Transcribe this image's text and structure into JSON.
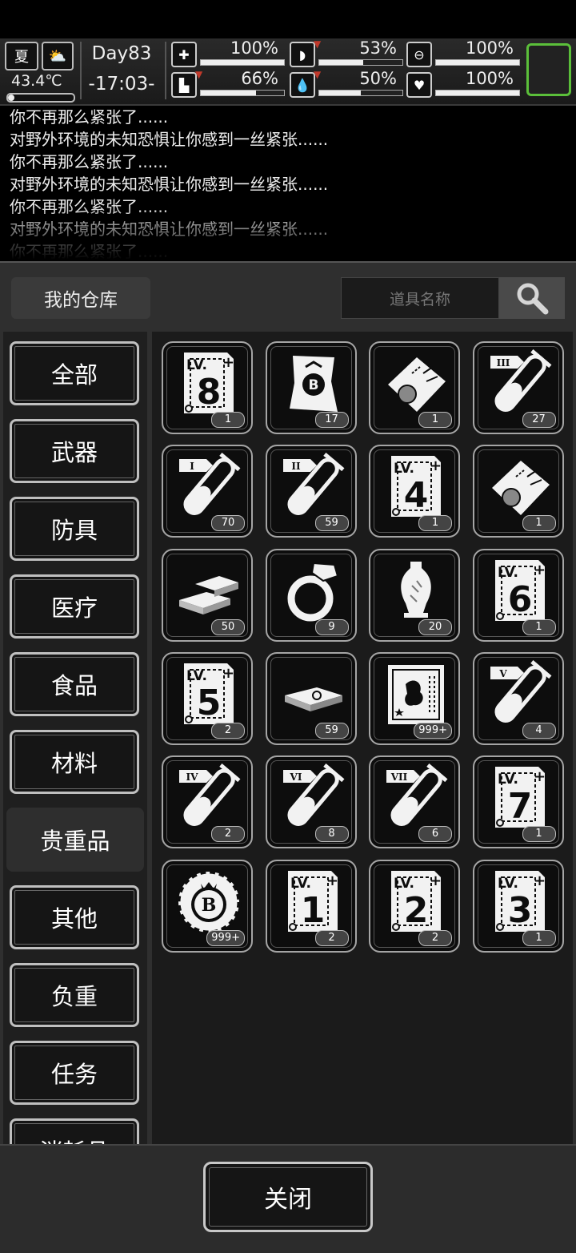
{
  "hud": {
    "season": "夏",
    "weather_icon": "sun-cloud-icon",
    "temperature": "43.4℃",
    "temperature_level": 0.1,
    "day": "Day83",
    "time": "-17:03-",
    "stats": [
      {
        "icon": "medkit-icon",
        "glyph": "✚",
        "value": "100%",
        "level": 1.0,
        "falling": false
      },
      {
        "icon": "stomach-icon",
        "glyph": "◗",
        "value": "53%",
        "level": 0.53,
        "falling": true
      },
      {
        "icon": "stamina-icon",
        "glyph": "⊖",
        "value": "100%",
        "level": 1.0,
        "falling": false
      },
      {
        "icon": "boot-icon",
        "glyph": "▙",
        "value": "66%",
        "level": 0.66,
        "falling": true
      },
      {
        "icon": "water-drop-icon",
        "glyph": "💧",
        "value": "50%",
        "level": 0.5,
        "falling": true
      },
      {
        "icon": "heart-icon",
        "glyph": "♥",
        "value": "100%",
        "level": 1.0,
        "falling": false
      }
    ],
    "accent_color": "#5bbf3a"
  },
  "log": [
    "你不再那么紧张了......",
    "对野外环境的未知恐惧让你感到一丝紧张......",
    "你不再那么紧张了......",
    "对野外环境的未知恐惧让你感到一丝紧张......",
    "你不再那么紧张了......",
    "对野外环境的未知恐惧让你感到一丝紧张......",
    "你不再那么紧张了......"
  ],
  "warehouse": {
    "title": "我的仓库",
    "search_placeholder": "道具名称",
    "categories": [
      "全部",
      "武器",
      "防具",
      "医疗",
      "食品",
      "材料",
      "贵重品",
      "其他",
      "负重",
      "任务",
      "消耗品"
    ],
    "active_category": "贵重品",
    "items": [
      {
        "type": "level-book",
        "label": "8",
        "count": "1"
      },
      {
        "type": "banknote",
        "label": "B",
        "count": "17"
      },
      {
        "type": "ticket",
        "label": "",
        "count": "1"
      },
      {
        "type": "test-tube",
        "label": "III",
        "count": "27"
      },
      {
        "type": "test-tube",
        "label": "I",
        "count": "70"
      },
      {
        "type": "test-tube",
        "label": "II",
        "count": "59"
      },
      {
        "type": "level-book",
        "label": "4",
        "count": "1"
      },
      {
        "type": "ticket",
        "label": "",
        "count": "1"
      },
      {
        "type": "gold-bars",
        "label": "",
        "count": "50"
      },
      {
        "type": "ring",
        "label": "",
        "count": "9"
      },
      {
        "type": "vase",
        "label": "",
        "count": "20"
      },
      {
        "type": "level-book",
        "label": "6",
        "count": "1"
      },
      {
        "type": "level-book",
        "label": "5",
        "count": "2"
      },
      {
        "type": "cash-stack",
        "label": "",
        "count": "59"
      },
      {
        "type": "film-card",
        "label": "",
        "count": "999+"
      },
      {
        "type": "test-tube",
        "label": "V",
        "count": "4"
      },
      {
        "type": "test-tube",
        "label": "IV",
        "count": "2"
      },
      {
        "type": "test-tube",
        "label": "VI",
        "count": "8"
      },
      {
        "type": "test-tube",
        "label": "VII",
        "count": "6"
      },
      {
        "type": "level-book",
        "label": "7",
        "count": "1"
      },
      {
        "type": "coin",
        "label": "B",
        "count": "999+"
      },
      {
        "type": "level-book",
        "label": "1",
        "count": "2"
      },
      {
        "type": "level-book",
        "label": "2",
        "count": "2"
      },
      {
        "type": "level-book",
        "label": "3",
        "count": "1"
      }
    ],
    "level_prefix": "LV.",
    "close_label": "关闭"
  }
}
